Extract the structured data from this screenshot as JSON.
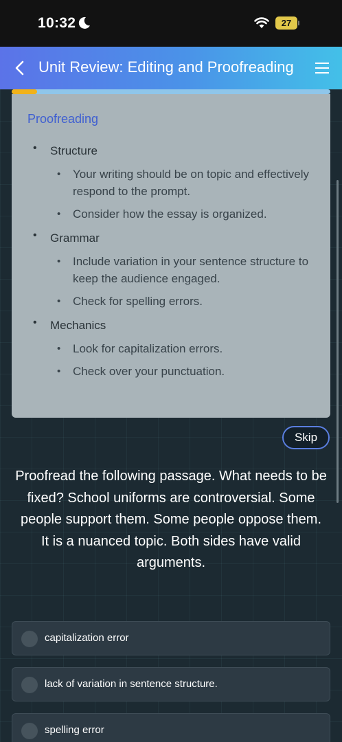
{
  "status_bar": {
    "time": "10:32",
    "battery": "27"
  },
  "header": {
    "title": "Unit Review: Editing and Proofreading"
  },
  "progress": {
    "fraction": 0.08
  },
  "card": {
    "title": "Proofreading",
    "sections": [
      {
        "label": "Structure",
        "items": [
          "Your writing should be on topic and effectively respond to the prompt.",
          "Consider how the essay is organized."
        ]
      },
      {
        "label": "Grammar",
        "items": [
          "Include variation in your sentence structure to keep the audience engaged.",
          "Check for spelling errors."
        ]
      },
      {
        "label": "Mechanics",
        "items": [
          "Look for capitalization errors.",
          "Check over your punctuation."
        ]
      }
    ]
  },
  "skip_label": "Skip",
  "question": "Proofread the following passage. What needs to be fixed? School uniforms are controversial. Some people support them. Some people oppose them. It is a nuanced topic. Both sides have valid arguments.",
  "options": [
    "capitalization error",
    "lack of variation in sentence structure.",
    "spelling error"
  ],
  "colors": {
    "accent": "#5b73e8",
    "progress": "#f1b21a",
    "card_title": "#3f5fd1"
  }
}
